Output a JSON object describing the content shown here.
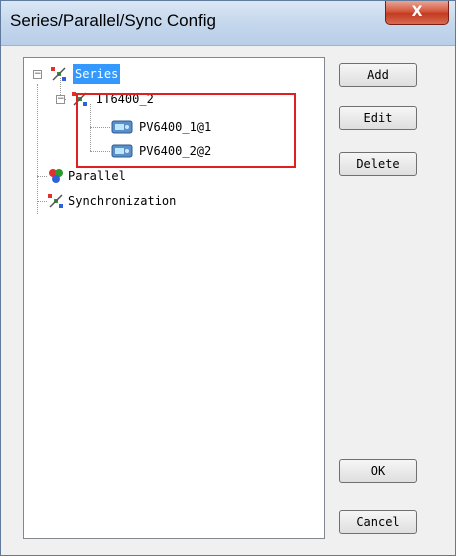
{
  "window": {
    "title": "Series/Parallel/Sync Config",
    "close_label": "X"
  },
  "tree": {
    "root": {
      "label": "Series",
      "expander": "−"
    },
    "series_child": {
      "label": "IT6400_2",
      "expander": "−"
    },
    "devices": [
      "PV6400_1@1",
      "PV6400_2@2"
    ],
    "parallel": {
      "label": "Parallel"
    },
    "sync": {
      "label": "Synchronization"
    }
  },
  "buttons": {
    "add": "Add",
    "edit": "Edit",
    "delete": "Delete",
    "ok": "OK",
    "cancel": "Cancel"
  },
  "colors": {
    "selection": "#3399ff",
    "highlight_box": "#e02020",
    "close_button": "#c23b22"
  }
}
